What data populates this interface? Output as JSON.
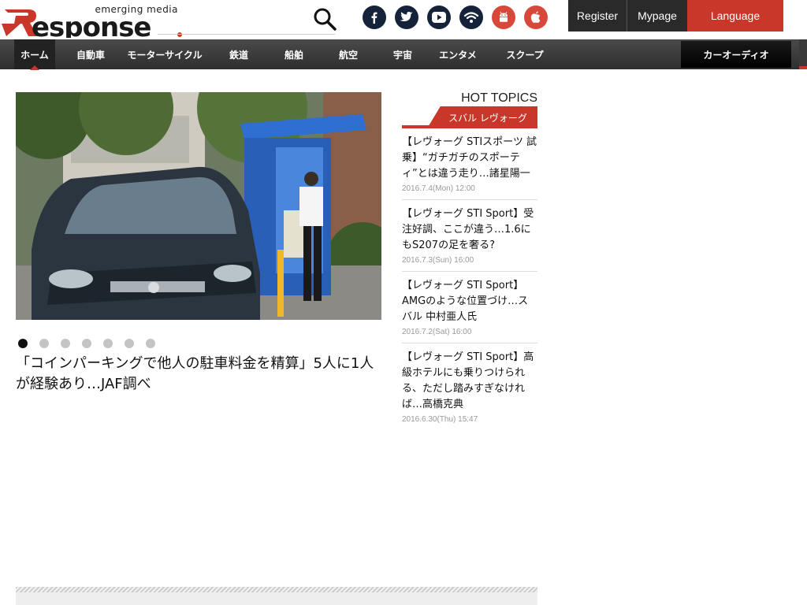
{
  "header": {
    "logo_text": "Response",
    "tagline": "emerging media",
    "search_icon": "search-icon",
    "social": [
      {
        "icon": "facebook-icon",
        "color": "#14233a"
      },
      {
        "icon": "twitter-icon",
        "color": "#14233a"
      },
      {
        "icon": "youtube-icon",
        "color": "#14233a"
      },
      {
        "icon": "rss-icon",
        "color": "#14233a"
      },
      {
        "icon": "android-icon",
        "color": "#d8483a"
      },
      {
        "icon": "apple-icon",
        "color": "#d8483a"
      }
    ],
    "register": "Register",
    "mypage": "Mypage",
    "language": "Language"
  },
  "nav": {
    "items": [
      "ホーム",
      "自動車",
      "モーターサイクル",
      "鉄道",
      "船舶",
      "航空",
      "宇宙",
      "エンタメ",
      "スクープ"
    ],
    "active": "ホーム",
    "special": "カーオーディオ"
  },
  "hero": {
    "title": "「コインパーキングで他人の駐車料金を精算」5人に1人が経験あり…JAF調べ",
    "slide_count": 7,
    "current_slide": 1
  },
  "hot_topics": {
    "heading": "HOT TOPICS",
    "tab": "スバル レヴォーグ",
    "items": [
      {
        "title": "【レヴォーグ STIスポーツ 試乗】“ガチガチのスポーティ”とは違う走り…諸星陽一",
        "date": "2016.7.4(Mon) 12:00"
      },
      {
        "title": "【レヴォーグ STI Sport】受注好調、ここが違う…1.6にもS207の足を奢る?",
        "date": "2016.7.3(Sun) 16:00"
      },
      {
        "title": "【レヴォーグ STI Sport】AMGのような位置づけ…スバル 中村亜人氏",
        "date": "2016.7.2(Sat) 16:00"
      },
      {
        "title": "【レヴォーグ STI Sport】高級ホテルにも乗りつけられる、ただし踏みすぎなければ…高橋克典",
        "date": "2016.6.30(Thu) 15:47"
      }
    ]
  },
  "colors": {
    "accent": "#c8372a",
    "nav_bg": "#3a3a3a",
    "social_dark": "#14233a",
    "social_red": "#d8483a"
  }
}
